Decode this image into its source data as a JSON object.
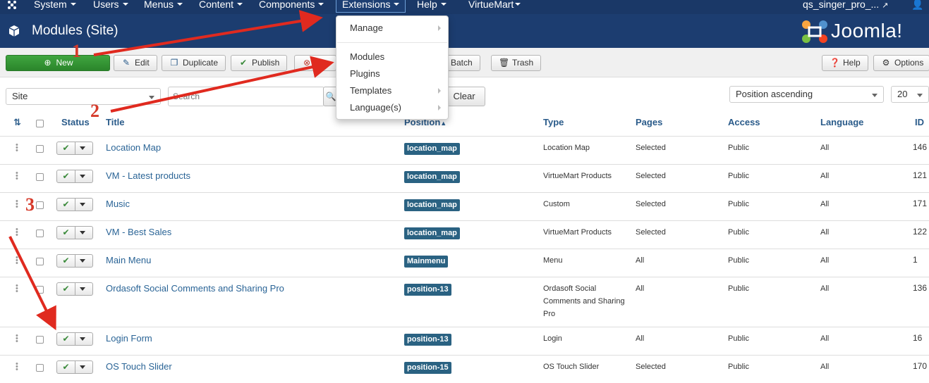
{
  "nav": {
    "items": [
      "System",
      "Users",
      "Menus",
      "Content",
      "Components",
      "Extensions",
      "Help",
      "VirtueMart"
    ],
    "user": "qs_singer_pro_..."
  },
  "header": {
    "title": "Modules (Site)",
    "logo_text": "Joomla!"
  },
  "toolbar": {
    "new": "New",
    "edit": "Edit",
    "duplicate": "Duplicate",
    "publish": "Publish",
    "batch": "Batch",
    "trash": "Trash",
    "help": "Help",
    "options": "Options"
  },
  "filters": {
    "client": "Site",
    "search_placeholder": "Search",
    "clear": "Clear",
    "ordering": "Position ascending",
    "limit": "20"
  },
  "table": {
    "headers": {
      "status": "Status",
      "title": "Title",
      "position": "Position",
      "type": "Type",
      "pages": "Pages",
      "access": "Access",
      "language": "Language",
      "id": "ID"
    },
    "rows": [
      {
        "title": "Location Map",
        "position": "location_map",
        "type": "Location Map",
        "pages": "Selected",
        "access": "Public",
        "language": "All",
        "id": "146"
      },
      {
        "title": "VM - Latest products",
        "position": "location_map",
        "type": "VirtueMart Products",
        "pages": "Selected",
        "access": "Public",
        "language": "All",
        "id": "121"
      },
      {
        "title": "Music",
        "position": "location_map",
        "type": "Custom",
        "pages": "Selected",
        "access": "Public",
        "language": "All",
        "id": "171"
      },
      {
        "title": "VM - Best Sales",
        "position": "location_map",
        "type": "VirtueMart Products",
        "pages": "Selected",
        "access": "Public",
        "language": "All",
        "id": "122"
      },
      {
        "title": "Main Menu",
        "position": "Mainmenu",
        "type": "Menu",
        "pages": "All",
        "access": "Public",
        "language": "All",
        "id": "1"
      },
      {
        "title": "Ordasoft Social Comments and Sharing Pro",
        "position": "position-13",
        "type_lines": [
          "Ordasoft Social",
          "Comments and Sharing",
          "Pro"
        ],
        "pages": "All",
        "access": "Public",
        "language": "All",
        "id": "136"
      },
      {
        "title": "Login Form",
        "position": "position-13",
        "type": "Login",
        "pages": "All",
        "access": "Public",
        "language": "All",
        "id": "16"
      },
      {
        "title": "OS Touch Slider",
        "position": "position-15",
        "type": "OS Touch Slider",
        "pages": "Selected",
        "access": "Public",
        "language": "All",
        "id": "170"
      }
    ]
  },
  "menu": {
    "items": [
      "Manage",
      "Modules",
      "Plugins",
      "Templates",
      "Language(s)"
    ]
  },
  "annotations": [
    "1",
    "2",
    "3"
  ],
  "colors": {
    "navbar": "#1a3867",
    "header": "#1c3d70",
    "new_button": "#2f8f2f",
    "arrow": "#e02a1f",
    "badge": "#2a6282"
  }
}
